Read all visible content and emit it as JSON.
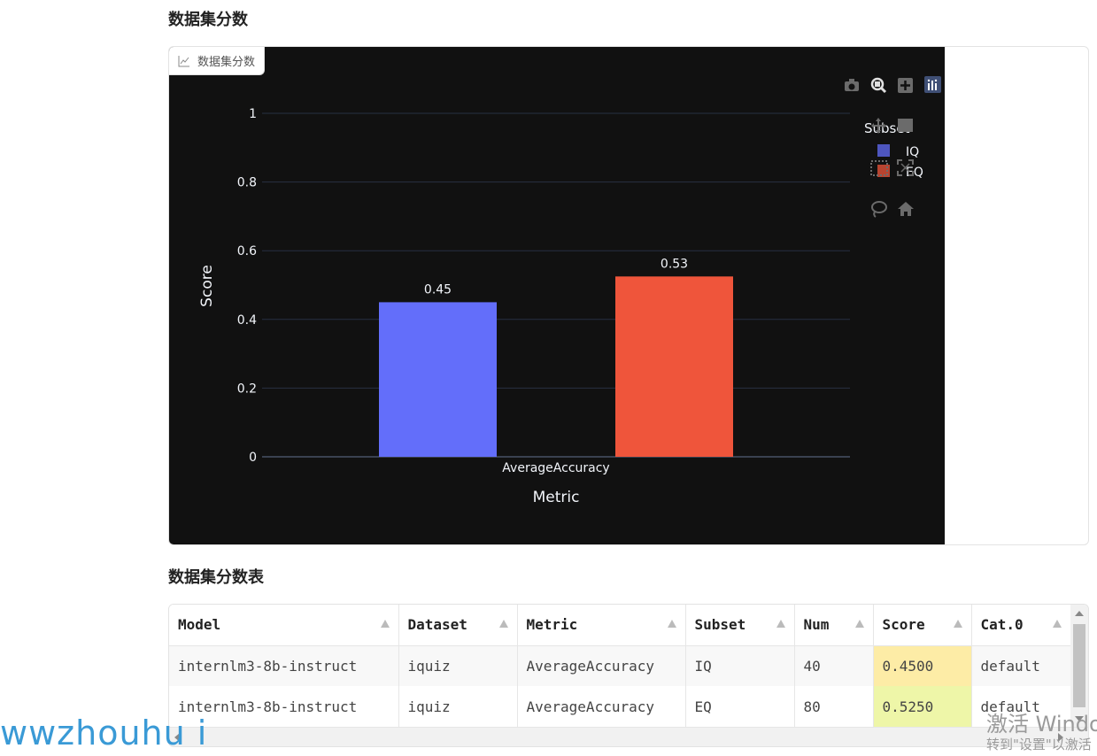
{
  "section1_title": "数据集分数",
  "section2_title": "数据集分数表",
  "chart_tab_label": "数据集分数",
  "modebar": [
    "camera-icon",
    "zoom-icon",
    "zoom-in-icon",
    "plotly-logo-icon",
    "pan-icon",
    "box-select-icon",
    "lasso-icon",
    "autoscale-icon",
    "home-icon"
  ],
  "chart_data": {
    "type": "bar",
    "categories": [
      "AverageAccuracy"
    ],
    "series": [
      {
        "name": "IQ",
        "values": [
          0.45
        ],
        "label": "0.45",
        "color": "#636efa"
      },
      {
        "name": "EQ",
        "values": [
          0.525
        ],
        "label": "0.53",
        "color": "#ef553b"
      }
    ],
    "xlabel": "Metric",
    "ylabel": "Score",
    "ylim": [
      0,
      1.0
    ],
    "yticks": [
      0,
      0.2,
      0.4,
      0.6,
      0.8,
      1
    ],
    "ytick_labels": [
      "0",
      "0.2",
      "0.4",
      "0.6",
      "0.8",
      "1"
    ],
    "legend_title": "Subset",
    "legend_position": "top-right",
    "grid": true,
    "background": "#111111"
  },
  "table": {
    "columns": [
      "Model",
      "Dataset",
      "Metric",
      "Subset",
      "Num",
      "Score",
      "Cat.0"
    ],
    "rows": [
      [
        "internlm3-8b-instruct",
        "iquiz",
        "AverageAccuracy",
        "IQ",
        "40",
        "0.4500",
        "default"
      ],
      [
        "internlm3-8b-instruct",
        "iquiz",
        "AverageAccuracy",
        "EQ",
        "80",
        "0.5250",
        "default"
      ]
    ],
    "score_colors": [
      "#fdeca6",
      "#eef6a8"
    ]
  },
  "watermark": "wwzhouhu i",
  "windows_notice": {
    "line1": "激活 Windo",
    "line2": "转到\"设置\"以激活"
  }
}
